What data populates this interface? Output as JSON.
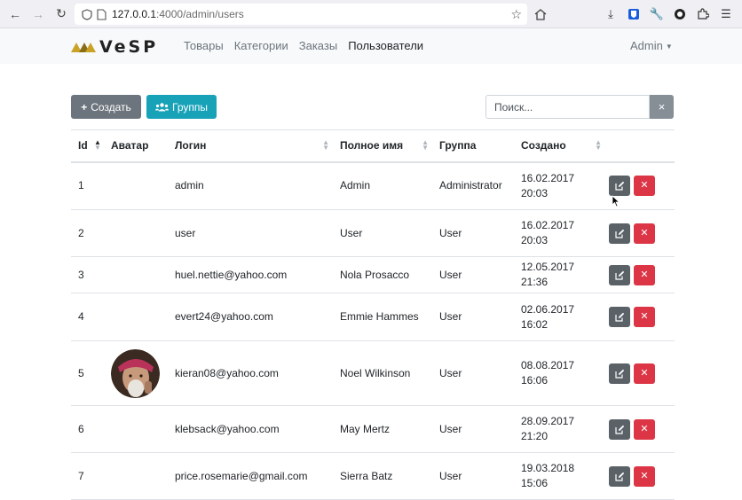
{
  "browser": {
    "url_host": "127.0.0.1",
    "url_path": ":4000/admin/users"
  },
  "navbar": {
    "brand": "VeSP",
    "links": [
      {
        "label": "Товары",
        "active": false
      },
      {
        "label": "Категории",
        "active": false
      },
      {
        "label": "Заказы",
        "active": false
      },
      {
        "label": "Пользователи",
        "active": true
      }
    ],
    "user_menu": "Admin"
  },
  "toolbar": {
    "create_label": "Создать",
    "groups_label": "Группы",
    "search_placeholder": "Поиск...",
    "search_value": "",
    "clear_label": "×"
  },
  "table": {
    "headers": {
      "id": "Id",
      "avatar": "Аватар",
      "login": "Логин",
      "fullname": "Полное имя",
      "group": "Группа",
      "created": "Создано"
    },
    "rows": [
      {
        "id": "1",
        "login": "admin",
        "fullname": "Admin",
        "group": "Administrator",
        "created_date": "16.02.2017",
        "created_time": "20:03",
        "avatar": false
      },
      {
        "id": "2",
        "login": "user",
        "fullname": "User",
        "group": "User",
        "created_date": "16.02.2017",
        "created_time": "20:03",
        "avatar": false
      },
      {
        "id": "3",
        "login": "huel.nettie@yahoo.com",
        "fullname": "Nola Prosacco",
        "group": "User",
        "created_date": "12.05.2017",
        "created_time": "21:36",
        "avatar": false
      },
      {
        "id": "4",
        "login": "evert24@yahoo.com",
        "fullname": "Emmie Hammes",
        "group": "User",
        "created_date": "02.06.2017",
        "created_time": "16:02",
        "avatar": false
      },
      {
        "id": "5",
        "login": "kieran08@yahoo.com",
        "fullname": "Noel Wilkinson",
        "group": "User",
        "created_date": "08.08.2017",
        "created_time": "16:06",
        "avatar": true
      },
      {
        "id": "6",
        "login": "klebsack@yahoo.com",
        "fullname": "May Mertz",
        "group": "User",
        "created_date": "28.09.2017",
        "created_time": "21:20",
        "avatar": false
      },
      {
        "id": "7",
        "login": "price.rosemarie@gmail.com",
        "fullname": "Sierra Batz",
        "group": "User",
        "created_date": "19.03.2018",
        "created_time": "15:06",
        "avatar": false
      }
    ]
  },
  "colors": {
    "secondary": "#6c757d",
    "info": "#17a2b8",
    "danger": "#dc3545",
    "brand_gold": "#c9a227"
  }
}
